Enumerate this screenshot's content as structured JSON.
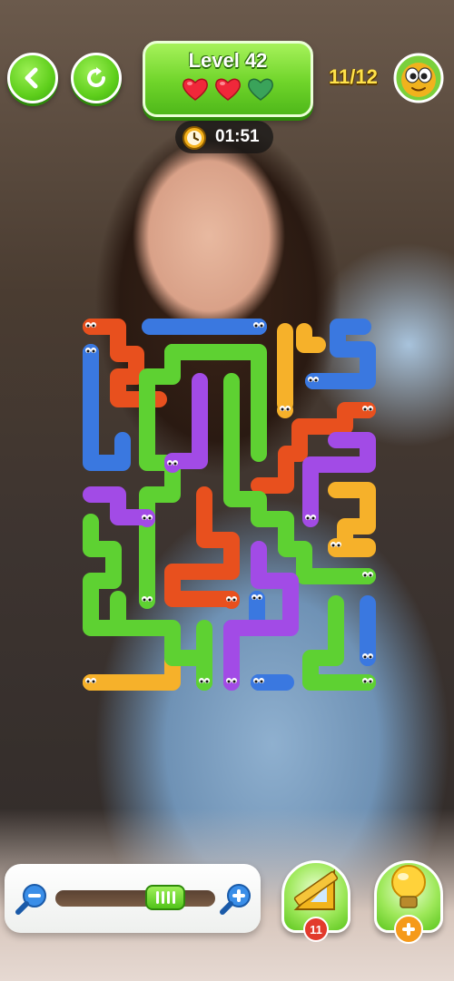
{
  "header": {
    "level_label": "Level 42",
    "hearts": [
      "filled",
      "filled",
      "empty"
    ],
    "timer": "01:51",
    "counter": "11/12",
    "icons": {
      "back": "back-arrow-icon",
      "restart": "restart-icon",
      "timer": "clock-icon",
      "avatar": "worm-face-icon"
    }
  },
  "board": {
    "worm_colors": {
      "red": "#e8501e",
      "blue": "#3a78e0",
      "orange": "#f6b12a",
      "green": "#5ed132",
      "purple": "#a24be6"
    },
    "worm_count": 12
  },
  "footer": {
    "zoom_level_percent": 75,
    "ruler_count": "11",
    "icons": {
      "zoom_out": "zoom-out-icon",
      "zoom_in": "zoom-in-icon",
      "ruler": "ruler-triangle-icon",
      "hint": "lightbulb-icon",
      "add": "plus-icon"
    }
  },
  "colors": {
    "accent_green": "#5fcf1c",
    "badge_red": "#e23a2c",
    "counter_yellow": "#ffe24a"
  }
}
